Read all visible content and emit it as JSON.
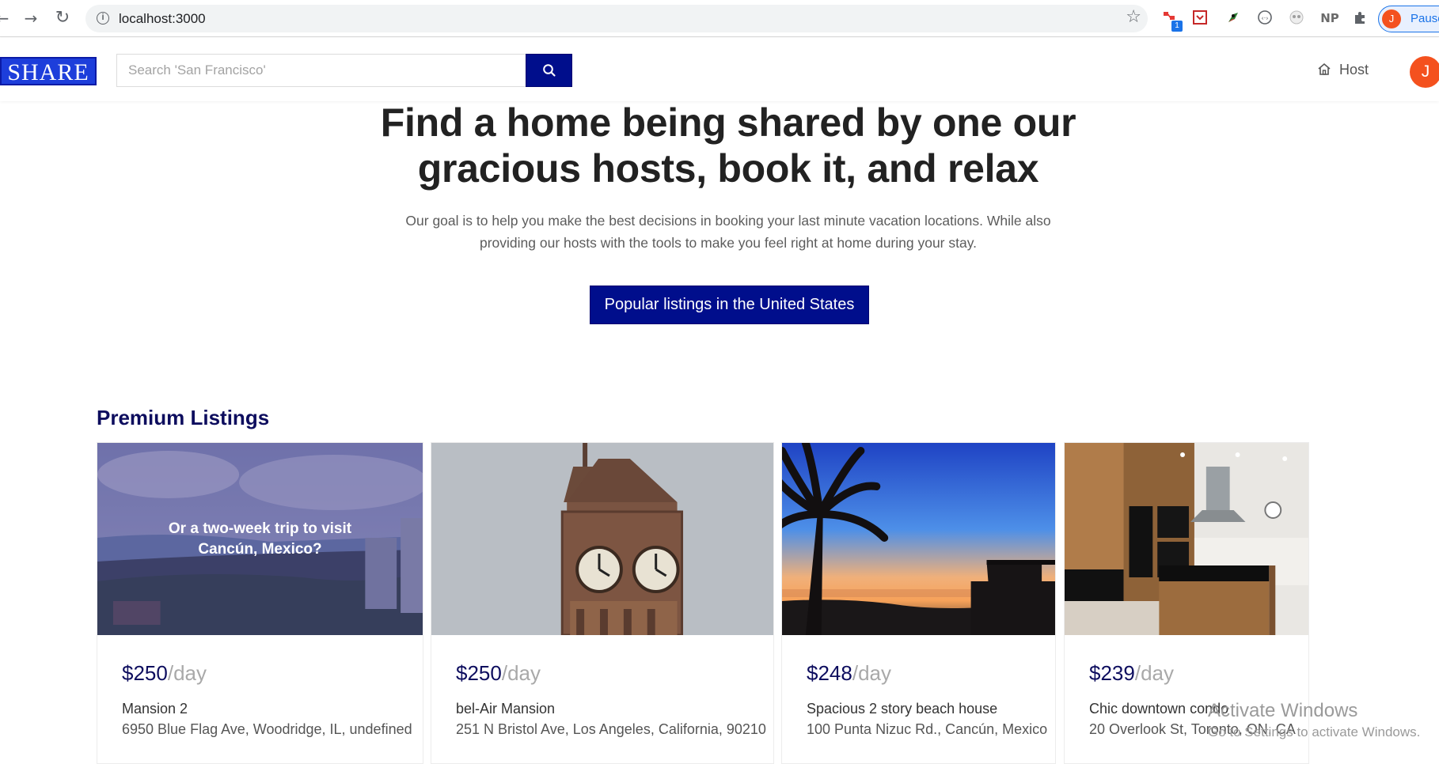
{
  "browser": {
    "url": "localhost:3000",
    "profile_label": "Pause",
    "profile_initial": "J",
    "extension_badge": "1",
    "extensions": [
      "np-icon"
    ],
    "extension_np_label": "NP"
  },
  "header": {
    "logo_text": "SHARE",
    "search_placeholder": "Search 'San Francisco'",
    "search_value": "",
    "host_label": "Host",
    "user_initial": "J"
  },
  "hero": {
    "title_line1": "Find a home being shared by one our",
    "title_line2": "gracious hosts, book it, and relax",
    "description_line1": "Our goal is to help you make the best decisions in booking your last minute vacation locations. While also",
    "description_line2": "providing our hosts with the tools to make you feel right at home during your stay.",
    "cta_label": "Popular listings in the United States"
  },
  "listings": {
    "section_title": "Premium Listings",
    "price_unit": "/day",
    "items": [
      {
        "price": "$250",
        "name": "Mansion 2",
        "address": "6950 Blue Flag Ave, Woodridge, IL, undefined",
        "overlay_line1": "Or a two-week trip to visit",
        "overlay_line2": "Cancún, Mexico?"
      },
      {
        "price": "$250",
        "name": "bel-Air Mansion",
        "address": "251 N Bristol Ave, Los Angeles, California, 90210"
      },
      {
        "price": "$248",
        "name": "Spacious 2 story beach house",
        "address": "100 Punta Nizuc Rd., Cancún, Mexico"
      },
      {
        "price": "$239",
        "name": "Chic downtown condo",
        "address": "20 Overlook St, Toronto, ON, CA"
      }
    ]
  },
  "watermark": {
    "line1": "Activate Windows",
    "line2": "Go to Settings to activate Windows."
  },
  "colors": {
    "brand_navy": "#000e8c",
    "logo_blue": "#1d3edb",
    "avatar_orange": "#f4511e"
  }
}
